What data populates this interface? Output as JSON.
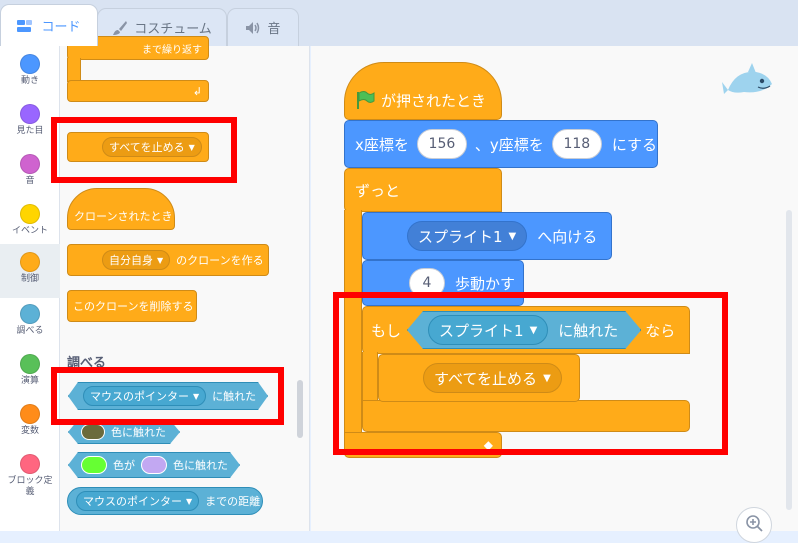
{
  "tabs": [
    {
      "label": "コード",
      "icon": "code-icon"
    },
    {
      "label": "コスチューム",
      "icon": "brush-icon"
    },
    {
      "label": "音",
      "icon": "speaker-icon"
    }
  ],
  "categories": [
    {
      "label": "動き",
      "color": "#4c97ff"
    },
    {
      "label": "見た目",
      "color": "#9966ff"
    },
    {
      "label": "音",
      "color": "#cf63cf"
    },
    {
      "label": "イベント",
      "color": "#ffd500"
    },
    {
      "label": "制御",
      "color": "#ffab19"
    },
    {
      "label": "調べる",
      "color": "#5cb1d6"
    },
    {
      "label": "演算",
      "color": "#59c059"
    },
    {
      "label": "変数",
      "color": "#ff8c1a"
    },
    {
      "label": "ブロック定義",
      "color": "#ff6680"
    }
  ],
  "palette": {
    "repeat_until_label": "まで繰り返す",
    "stop_all_option": "すべてを止める",
    "when_clone_label": "クローンされたとき",
    "create_clone_option": "自分自身",
    "create_clone_suffix": "のクローンを作る",
    "delete_clone_label": "このクローンを削除する",
    "sensing_title": "調べる",
    "touching_option": "マウスのポインター",
    "touching_suffix": "に触れた",
    "touching_color_label": "色に触れた",
    "color_touching_mid": "色が",
    "color_touching_suffix": "色に触れた",
    "distance_option": "マウスのポインター",
    "distance_suffix": "までの距離"
  },
  "script": {
    "hat_label": "が押されたとき",
    "goto_x_label": "x座標を",
    "goto_x_value": "156",
    "goto_sep": "、y座標を",
    "goto_y_value": "118",
    "goto_suffix": "にする",
    "forever_label": "ずっと",
    "point_option": "スプライト1",
    "point_suffix": "へ向ける",
    "move_value": "4",
    "move_suffix": "歩動かす",
    "if_label": "もし",
    "if_touch_option": "スプライト1",
    "if_touch_suffix": "に触れた",
    "if_then": "なら",
    "stop_option": "すべてを止める"
  },
  "colors": {
    "motion": "#4c97ff",
    "control": "#ffab19",
    "sensing": "#5cb1d6",
    "highlight": "#ff0000"
  }
}
